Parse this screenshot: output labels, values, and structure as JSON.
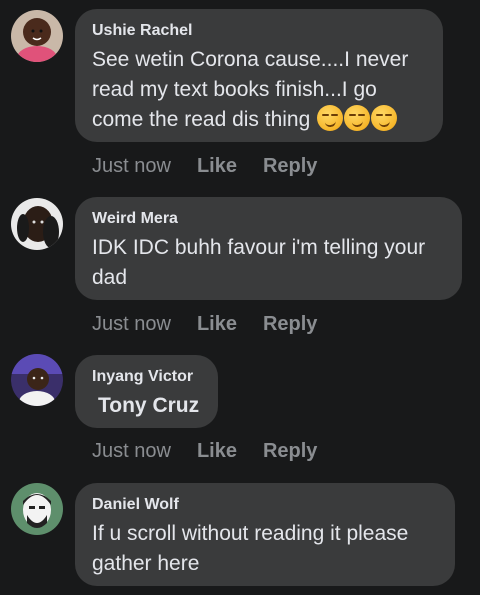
{
  "comments": [
    {
      "author": "Ushie Rachel",
      "text": "See wetin Corona cause....I never read my text books finish...I go come the read dis thing",
      "emoji": [
        "smirk-emoji",
        "smirk-emoji",
        "smirk-emoji"
      ],
      "time": "Just now",
      "like_label": "Like",
      "reply_label": "Reply"
    },
    {
      "author": "Weird Mera",
      "text": "IDK IDC buhh favour i'm telling your dad",
      "time": "Just now",
      "like_label": "Like",
      "reply_label": "Reply"
    },
    {
      "author": "Inyang Victor",
      "text": "Tony Cruz",
      "time": "Just now",
      "like_label": "Like",
      "reply_label": "Reply"
    },
    {
      "author": "Daniel Wolf",
      "text": "If u scroll without reading it please gather here"
    }
  ],
  "colors": {
    "background": "#18191a",
    "bubble": "#3a3b3c",
    "text": "#e4e6eb",
    "muted": "#8a8d91"
  }
}
